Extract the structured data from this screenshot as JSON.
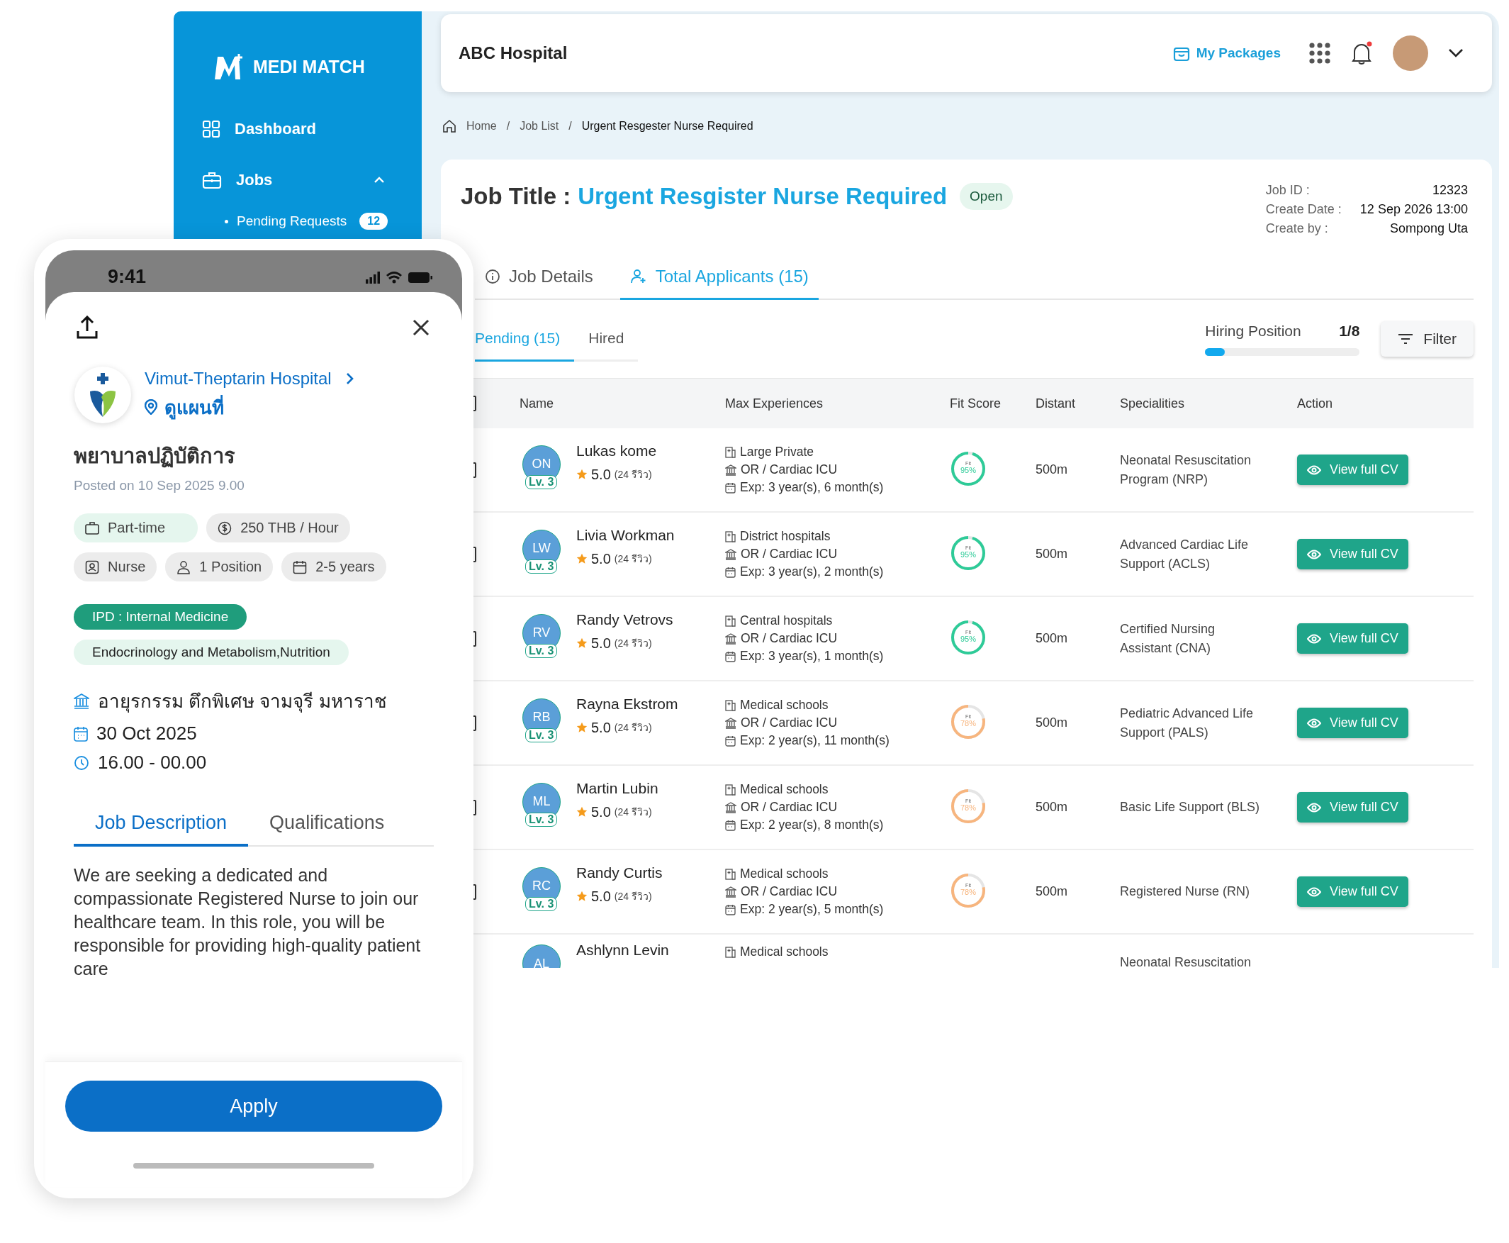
{
  "sidebar": {
    "brand": "MEDI MATCH",
    "items": [
      {
        "label": "Dashboard"
      },
      {
        "label": "Jobs",
        "expanded": true,
        "children": [
          {
            "label": "Pending Requests",
            "badge": "12"
          }
        ]
      }
    ]
  },
  "header": {
    "title": "ABC Hospital",
    "packages": "My Packages",
    "notification": true
  },
  "breadcrumb": [
    {
      "label": "Home"
    },
    {
      "separator": "/",
      "label": "Job List"
    },
    {
      "separator": "/",
      "label": "Urgent Resgester Nurse Required"
    }
  ],
  "job": {
    "label": "Job Title :",
    "title": "Urgent Resgister Nurse Required",
    "status": "Open",
    "meta": [
      {
        "label": "Job ID :",
        "value": "12323"
      },
      {
        "label": "Create Date :",
        "value": "12 Sep 2026 13:00"
      },
      {
        "label": "Create by :",
        "value": "Sompong Uta"
      }
    ],
    "tabs": [
      {
        "label": "Job Details",
        "selected": false
      },
      {
        "label": "Total Applicants (15)",
        "selected": true
      }
    ],
    "subtabs": [
      {
        "label": "Pending (15)",
        "selected": true
      },
      {
        "label": "Hired",
        "selected": false
      }
    ],
    "hiring": {
      "label": "Hiring Position",
      "reading": "1/8",
      "level": 0.125
    },
    "filter": "Filter"
  },
  "table": {
    "columns": [
      "Name",
      "Max Experiences",
      "Fit Score",
      "Distant",
      "Specialities",
      "Action"
    ],
    "header_checked": false,
    "rows": [
      {
        "initials": "ON",
        "level_badge": "Lv. 3",
        "name": "Lukas kome",
        "rating": "5.0",
        "reviews": "(24 รีวิว)",
        "hospital": "Large Private",
        "unit": "OR / Cardiac ICU",
        "exp": "Exp: 3 year(s), 6 month(s)",
        "fit_label": "Fit",
        "fit": "95%",
        "level": 0.95,
        "color": "#2ecb98",
        "distance": "500m",
        "speciality": "Neonatal Resuscitation Program (NRP)",
        "action": "View full CV",
        "checked": false
      },
      {
        "initials": "LW",
        "level_badge": "Lv. 3",
        "name": "Livia Workman",
        "rating": "5.0",
        "reviews": "(24 รีวิว)",
        "hospital": "District hospitals",
        "unit": "OR / Cardiac ICU",
        "exp": "Exp: 3 year(s), 2 month(s)",
        "fit_label": "Fit",
        "fit": "95%",
        "level": 0.95,
        "color": "#2ecb98",
        "distance": "500m",
        "speciality": "Advanced Cardiac Life Support (ACLS)",
        "action": "View full CV",
        "checked": false
      },
      {
        "initials": "RV",
        "level_badge": "Lv. 3",
        "name": "Randy Vetrovs",
        "rating": "5.0",
        "reviews": "(24 รีวิว)",
        "hospital": "Central hospitals",
        "unit": "OR / Cardiac ICU",
        "exp": "Exp: 3 year(s), 1 month(s)",
        "fit_label": "Fit",
        "fit": "95%",
        "level": 0.95,
        "color": "#2ecb98",
        "distance": "500m",
        "speciality": "Certified Nursing Assistant (CNA)",
        "action": "View full CV",
        "checked": false
      },
      {
        "initials": "RB",
        "level_badge": "Lv. 3",
        "name": "Rayna Ekstrom",
        "rating": "5.0",
        "reviews": "(24 รีวิว)",
        "hospital": "Medical schools",
        "unit": "OR / Cardiac ICU",
        "exp": "Exp: 2 year(s), 11 month(s)",
        "fit_label": "Fit",
        "fit": "78%",
        "level": 0.78,
        "color": "#f7b57e",
        "distance": "500m",
        "speciality": "Pediatric Advanced Life Support (PALS)",
        "action": "View full CV",
        "checked": false
      },
      {
        "initials": "ML",
        "level_badge": "Lv. 3",
        "name": "Martin Lubin",
        "rating": "5.0",
        "reviews": "(24 รีวิว)",
        "hospital": "Medical schools",
        "unit": "OR / Cardiac ICU",
        "exp": "Exp: 2 year(s), 8 month(s)",
        "fit_label": "Fit",
        "fit": "78%",
        "level": 0.78,
        "color": "#f7b57e",
        "distance": "500m",
        "speciality": "Basic Life Support (BLS)",
        "action": "View full CV",
        "checked": false
      },
      {
        "initials": "RC",
        "level_badge": "Lv. 3",
        "name": "Randy Curtis",
        "rating": "5.0",
        "reviews": "(24 รีวิว)",
        "hospital": "Medical schools",
        "unit": "OR / Cardiac ICU",
        "exp": "Exp: 2 year(s), 5 month(s)",
        "fit_label": "Fit",
        "fit": "78%",
        "level": 0.78,
        "color": "#f7b57e",
        "distance": "500m",
        "speciality": "Registered Nurse (RN)",
        "action": "View full CV",
        "checked": false
      },
      {
        "initials": "AL",
        "name": "Ashlynn Levin",
        "hospital": "Medical schools",
        "speciality": "Neonatal Resuscitation"
      }
    ]
  },
  "phone": {
    "time": "9:41",
    "hospital": "Vimut-Theptarin Hospital",
    "map_link": "ดูแผนที่",
    "title": "พยาบาลปฏิบัติการ",
    "posted": "Posted on 10 Sep 2025 9.00",
    "chips": [
      {
        "label": "Part-time",
        "kind": "highlight"
      },
      {
        "label": "250 THB / Hour",
        "kind": "plain"
      },
      {
        "label": "Nurse",
        "kind": "plain"
      },
      {
        "label": "1 Position",
        "kind": "plain"
      },
      {
        "label": "2-5 years",
        "kind": "plain"
      }
    ],
    "tags": [
      {
        "label": "IPD : Internal Medicine",
        "kind": "solid"
      },
      {
        "label": "Endocrinology and Metabolism,Nutrition",
        "kind": "soft"
      }
    ],
    "info": [
      {
        "text": "อายุรกรรม ตึกพิเศษ จามจุรี มหาราช"
      },
      {
        "text": "30 Oct 2025"
      },
      {
        "text": "16.00 - 00.00"
      }
    ],
    "tabs": [
      {
        "label": "Job Description",
        "selected": true
      },
      {
        "label": "Qualifications",
        "selected": false
      }
    ],
    "description": "We are seeking a dedicated and compassionate Registered Nurse to join our healthcare team. In this role, you will be responsible for providing high-quality patient care",
    "apply": "Apply"
  }
}
